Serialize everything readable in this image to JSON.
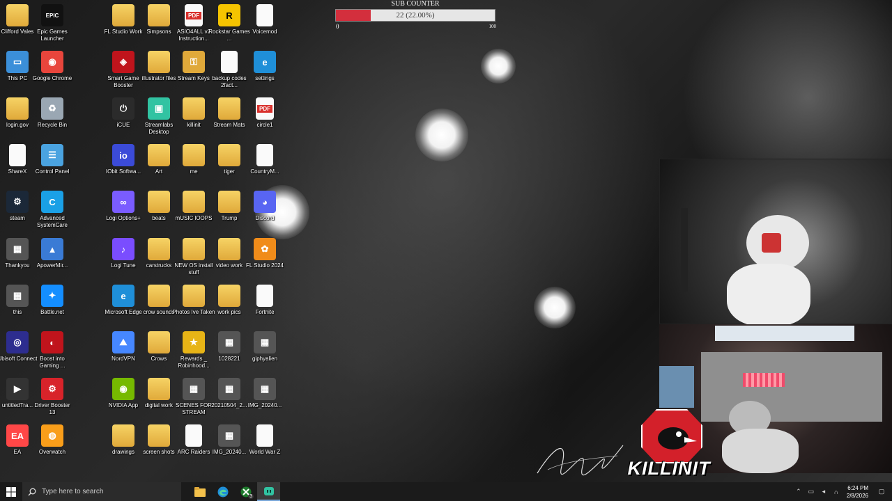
{
  "sub_counter": {
    "title": "SUB COUNTER",
    "value_text": "22 (22.00%)",
    "progress_percent": 22,
    "min": "0",
    "max": "100",
    "fill_color": "#d32f3d"
  },
  "desktop_icons": [
    {
      "label": "Clifford Vales",
      "icon": "folder-icon"
    },
    {
      "label": "Epic Games Launcher",
      "icon": "epic-games-icon"
    },
    {
      "label": "FL Studio Work",
      "icon": "folder-icon"
    },
    {
      "label": "Simpsons",
      "icon": "folder-icon"
    },
    {
      "label": "ASIO4ALL v2 Instruction...",
      "icon": "pdf-icon"
    },
    {
      "label": "Rockstar Games ...",
      "icon": "rockstar-icon"
    },
    {
      "label": "Voicemod",
      "icon": "file-icon"
    },
    {
      "label": "This PC",
      "icon": "computer-icon"
    },
    {
      "label": "Google Chrome",
      "icon": "chrome-icon"
    },
    {
      "label": "Smart Game Booster",
      "icon": "game-booster-icon"
    },
    {
      "label": "illustrator files",
      "icon": "folder-icon"
    },
    {
      "label": "Stream Keys",
      "icon": "key-icon"
    },
    {
      "label": "backup codes 2fact...",
      "icon": "file-icon"
    },
    {
      "label": "settings",
      "icon": "edge-icon"
    },
    {
      "label": "login.gov",
      "icon": "folder-icon"
    },
    {
      "label": "Recycle Bin",
      "icon": "recycle-bin-icon"
    },
    {
      "label": "iCUE",
      "icon": "icue-icon"
    },
    {
      "label": "Streamlabs Desktop",
      "icon": "streamlabs-icon"
    },
    {
      "label": "killinit",
      "icon": "folder-icon"
    },
    {
      "label": "Stream Mats",
      "icon": "folder-icon"
    },
    {
      "label": "circle1",
      "icon": "pdf-icon"
    },
    {
      "label": "ShareX",
      "icon": "file-icon"
    },
    {
      "label": "Control Panel",
      "icon": "control-panel-icon"
    },
    {
      "label": "IObit Softwa...",
      "icon": "iobit-icon"
    },
    {
      "label": "Art",
      "icon": "folder-icon"
    },
    {
      "label": "me",
      "icon": "folder-icon"
    },
    {
      "label": "tiger",
      "icon": "folder-icon"
    },
    {
      "label": "CountryM...",
      "icon": "file-icon"
    },
    {
      "label": "steam",
      "icon": "steam-icon"
    },
    {
      "label": "Advanced SystemCare",
      "icon": "systemcare-icon"
    },
    {
      "label": "Logi Options+",
      "icon": "logi-icon"
    },
    {
      "label": "beats",
      "icon": "folder-icon"
    },
    {
      "label": "mUSIC lOOPS",
      "icon": "folder-icon"
    },
    {
      "label": "Trump",
      "icon": "folder-icon"
    },
    {
      "label": "Discord",
      "icon": "discord-icon"
    },
    {
      "label": "Thankyou",
      "icon": "image-icon"
    },
    {
      "label": "ApowerMir...",
      "icon": "apowermirror-icon"
    },
    {
      "label": "Logi Tune",
      "icon": "logi-tune-icon"
    },
    {
      "label": "carstrucks",
      "icon": "folder-icon"
    },
    {
      "label": "NEW OS install stuff",
      "icon": "folder-icon"
    },
    {
      "label": "video work",
      "icon": "folder-icon"
    },
    {
      "label": "FL Studio 2024",
      "icon": "fl-studio-icon"
    },
    {
      "label": "this",
      "icon": "image-icon"
    },
    {
      "label": "Battle.net",
      "icon": "battlenet-icon"
    },
    {
      "label": "Microsoft Edge",
      "icon": "edge-icon"
    },
    {
      "label": "crow sounds",
      "icon": "folder-icon"
    },
    {
      "label": "Photos Ive Taken",
      "icon": "folder-icon"
    },
    {
      "label": "work pics",
      "icon": "folder-icon"
    },
    {
      "label": "Fortnite",
      "icon": "file-icon"
    },
    {
      "label": "Ubisoft Connect",
      "icon": "ubisoft-icon"
    },
    {
      "label": "Boost into Gaming ...",
      "icon": "boost-icon"
    },
    {
      "label": "NordVPN",
      "icon": "nordvpn-icon"
    },
    {
      "label": "Crows",
      "icon": "folder-icon"
    },
    {
      "label": "Rewards _ Robinhood...",
      "icon": "star-icon"
    },
    {
      "label": "1028221",
      "icon": "image-icon"
    },
    {
      "label": "giphyalien",
      "icon": "image-icon"
    },
    {
      "label": "untitledTra...",
      "icon": "video-icon"
    },
    {
      "label": "Driver Booster 13",
      "icon": "driver-booster-icon"
    },
    {
      "label": "NVIDIA App",
      "icon": "nvidia-icon"
    },
    {
      "label": "digital work",
      "icon": "folder-icon"
    },
    {
      "label": "SCENES FOR STREAM",
      "icon": "image-icon"
    },
    {
      "label": "20210504_2...",
      "icon": "image-icon"
    },
    {
      "label": "IMG_20240...",
      "icon": "image-icon"
    },
    {
      "label": "EA",
      "icon": "ea-icon"
    },
    {
      "label": "Overwatch",
      "icon": "overwatch-icon"
    },
    {
      "label": "drawings",
      "icon": "folder-icon"
    },
    {
      "label": "screen shots",
      "icon": "folder-icon"
    },
    {
      "label": "ARC Raiders",
      "icon": "file-icon"
    },
    {
      "label": "IMG_20240...",
      "icon": "image-icon"
    },
    {
      "label": "World War Z",
      "icon": "file-icon"
    }
  ],
  "overlay": {
    "logo_text": "KILLINIT"
  },
  "taskbar": {
    "search_placeholder": "Type here to search",
    "apps": [
      {
        "name": "file-explorer-icon",
        "badge": ""
      },
      {
        "name": "edge-icon",
        "badge": ""
      },
      {
        "name": "xbox-icon",
        "badge": "3"
      },
      {
        "name": "streamlabs-icon",
        "badge": ""
      }
    ],
    "time": "6:24 PM",
    "date": "2/8/2026"
  }
}
